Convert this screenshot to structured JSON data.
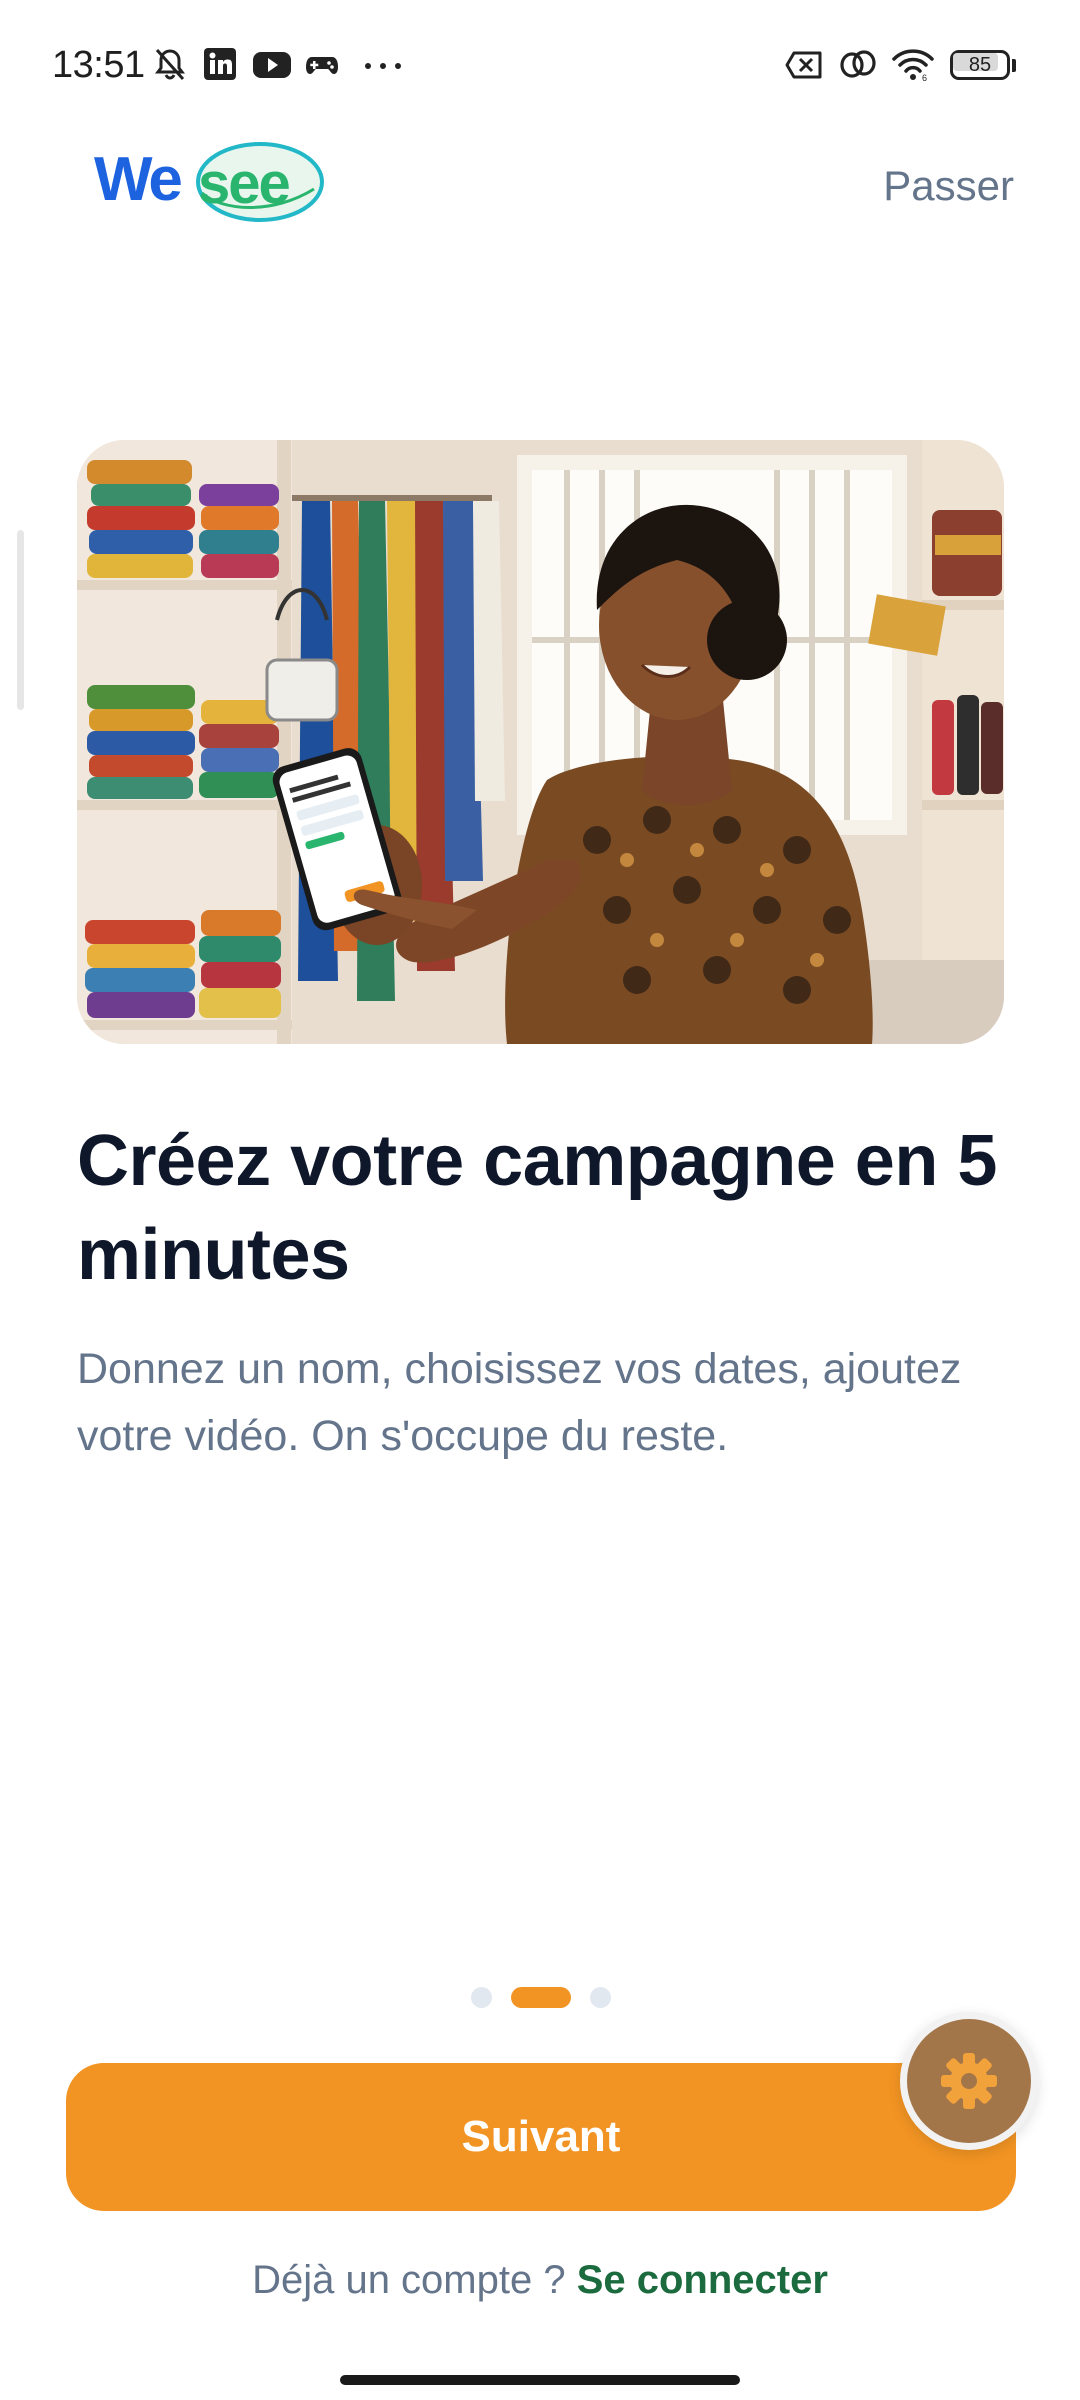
{
  "status_bar": {
    "time": "13:51",
    "battery_level": "85",
    "icons": [
      "bell-off-icon",
      "linkedin-icon",
      "youtube-icon",
      "gamepad-icon",
      "more-dots-icon",
      "sim-off-icon",
      "link-icon",
      "wifi-icon",
      "battery-icon"
    ]
  },
  "header": {
    "logo_text": "Wesee",
    "skip_label": "Passer"
  },
  "slide": {
    "title": "Créez votre campagne en 5 minutes",
    "description": "Donnez un nom, choisissez vos dates, ajoutez votre vidéo. On s'occupe du reste."
  },
  "pager": {
    "total": 3,
    "active_index": 1
  },
  "actions": {
    "next_label": "Suivant",
    "login_prompt": "Déjà un compte ?",
    "login_link": "Se connecter"
  },
  "fab": {
    "icon": "gear-icon"
  },
  "colors": {
    "accent": "#f29423",
    "logo_blue": "#1d63e0",
    "logo_green": "#2ab56f",
    "login_link": "#1b6b3f",
    "title": "#0f172a",
    "muted": "#64748b"
  }
}
